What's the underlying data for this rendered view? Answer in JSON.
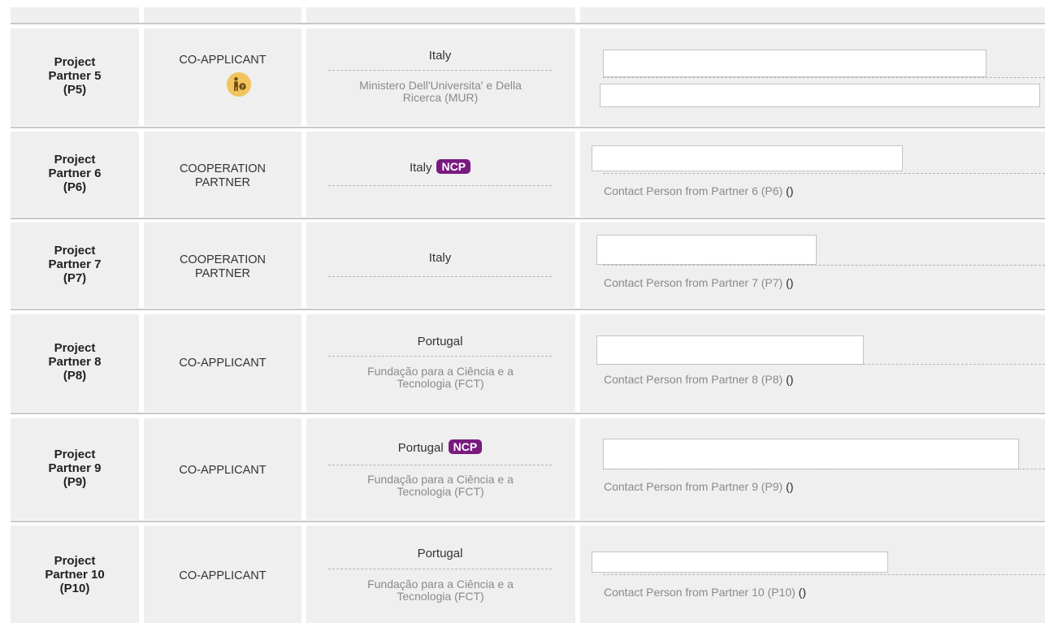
{
  "rows": [
    {
      "name": [
        "Project",
        "Partner 5",
        "(P5)"
      ],
      "type": [
        "CO-APPLICANT"
      ],
      "country": "Italy",
      "ncp": "",
      "org": [
        "Ministero Dell'Universita' e Della",
        "Ricerca (MUR)"
      ],
      "contact": "",
      "icon": "person-help-icon"
    },
    {
      "name": [
        "Project",
        "Partner 6",
        "(P6)"
      ],
      "type": [
        "COOPERATION",
        "PARTNER"
      ],
      "country": "Italy",
      "ncp": "NCP",
      "org": [],
      "contact": "Contact Person from Partner 6 (P6)"
    },
    {
      "name": [
        "Project",
        "Partner 7",
        "(P7)"
      ],
      "type": [
        "COOPERATION",
        "PARTNER"
      ],
      "country": "Italy",
      "ncp": "",
      "org": [],
      "contact": "Contact Person from Partner 7 (P7)"
    },
    {
      "name": [
        "Project",
        "Partner 8",
        "(P8)"
      ],
      "type": [
        "CO-APPLICANT"
      ],
      "country": "Portugal",
      "ncp": "",
      "org": [
        "Fundação para a Ciência e a",
        "Tecnologia (FCT)"
      ],
      "contact": "Contact Person from Partner 8 (P8)"
    },
    {
      "name": [
        "Project",
        "Partner 9",
        "(P9)"
      ],
      "type": [
        "CO-APPLICANT"
      ],
      "country": "Portugal",
      "ncp": "NCP",
      "org": [
        "Fundação para a Ciência e a",
        "Tecnologia (FCT)"
      ],
      "contact": "Contact Person from Partner 9 (P9)"
    },
    {
      "name": [
        "Project",
        "Partner 10",
        "(P10)"
      ],
      "type": [
        "CO-APPLICANT"
      ],
      "country": "Portugal",
      "ncp": "",
      "org": [
        "Fundação para a Ciência e a",
        "Tecnologia (FCT)"
      ],
      "contact": "Contact Person from Partner 10 (P10)"
    }
  ],
  "contact_paren": "()",
  "colors": {
    "ncp_badge": "#7a1a7f",
    "help_badge": "#f2c45e",
    "cell_bg": "#efefef"
  }
}
